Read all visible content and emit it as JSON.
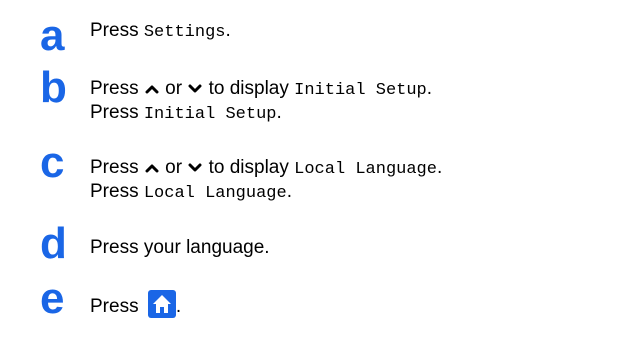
{
  "steps": [
    {
      "letter": "a",
      "line1": {
        "prefix": "Press ",
        "mono": "Settings",
        "suffix": "."
      }
    },
    {
      "letter": "b",
      "line1": {
        "prefix": "Press ",
        "or": " or ",
        "mid": " to display ",
        "mono": "Initial Setup",
        "suffix": "."
      },
      "line2": {
        "prefix": "Press ",
        "mono": "Initial Setup",
        "suffix": "."
      }
    },
    {
      "letter": "c",
      "line1": {
        "prefix": "Press ",
        "or": " or ",
        "mid": " to display ",
        "mono": "Local Language",
        "suffix": "."
      },
      "line2": {
        "prefix": "Press ",
        "mono": "Local Language",
        "suffix": "."
      }
    },
    {
      "letter": "d",
      "line1": {
        "text": "Press your language."
      }
    },
    {
      "letter": "e",
      "line1": {
        "prefix": "Press ",
        "suffix": "."
      },
      "icon": "home-icon"
    }
  ],
  "colors": {
    "step_letter": "#1a66e6",
    "home_button_bg": "#1a66e6",
    "text": "#000000"
  }
}
